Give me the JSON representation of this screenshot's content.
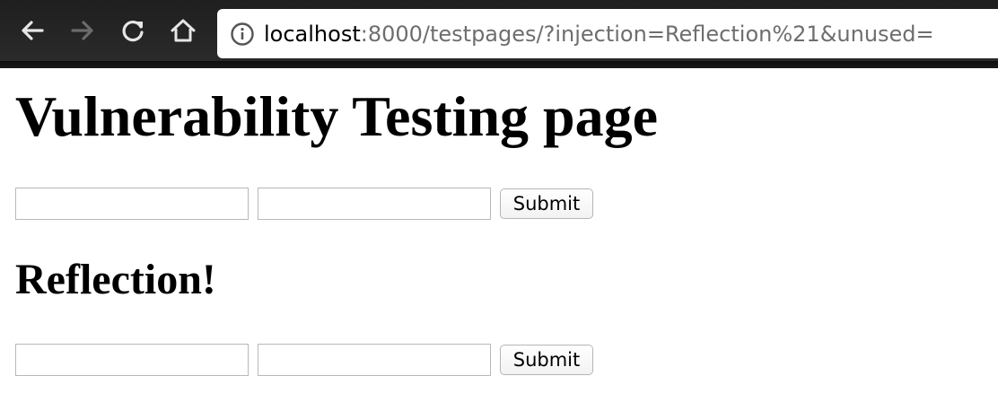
{
  "browser": {
    "url_host": "localhost",
    "url_rest": ":8000/testpages/?injection=Reflection%21&unused="
  },
  "page": {
    "title": "Vulnerability Testing page",
    "forms": [
      {
        "input1_value": "",
        "input2_value": "",
        "submit_label": "Submit"
      },
      {
        "input1_value": "",
        "input2_value": "",
        "submit_label": "Submit"
      }
    ],
    "reflected_text": "Reflection!"
  },
  "colors": {
    "toolbar_bg": "#222222",
    "url_host_text": "#000000",
    "url_path_text": "#6e6e6e",
    "icon_active": "#e6e6e6",
    "icon_disabled": "#6b6b6b"
  }
}
